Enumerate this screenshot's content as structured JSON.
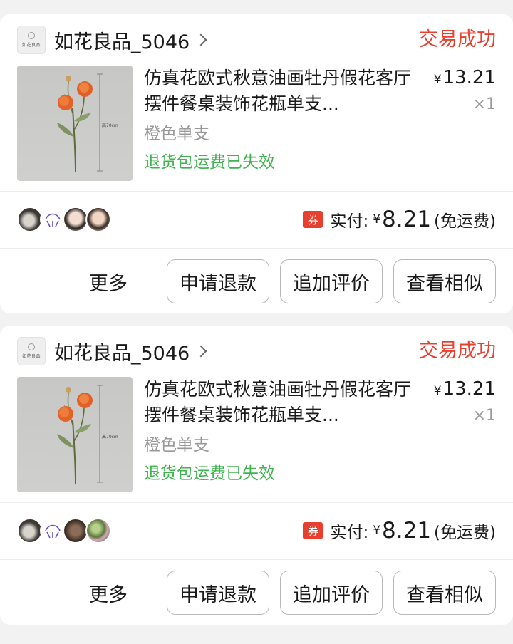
{
  "orders": [
    {
      "shop_name": "如花良品_5046",
      "shop_logo_text": "如花良品",
      "status": "交易成功",
      "product_title": "仿真花欧式秋意油画牡丹假花客厅摆件餐桌装饰花瓶单支...",
      "price_symbol": "¥",
      "price": "13.21",
      "quantity": "×1",
      "spec": "橙色单支",
      "return_note": "退货包运费已失效",
      "image_height_label": "高70cm",
      "avatars": [
        "cat-avatar",
        "sketch-avatar",
        "girl-avatar",
        "girl-avatar"
      ],
      "coupon_label": "券",
      "paid_label": "实付:",
      "paid_symbol": "¥",
      "paid_amount": "8.21",
      "paid_note": "(免运费)",
      "more_label": "更多",
      "buttons": {
        "refund": "申请退款",
        "add_review": "追加评价",
        "similar": "查看相似"
      }
    },
    {
      "shop_name": "如花良品_5046",
      "shop_logo_text": "如花良品",
      "status": "交易成功",
      "product_title": "仿真花欧式秋意油画牡丹假花客厅摆件餐桌装饰花瓶单支...",
      "price_symbol": "¥",
      "price": "13.21",
      "quantity": "×1",
      "spec": "橙色单支",
      "return_note": "退货包运费已失效",
      "image_height_label": "高70cm",
      "avatars": [
        "cat-avatar",
        "sketch-avatar",
        "dark-avatar",
        "plant-avatar"
      ],
      "coupon_label": "券",
      "paid_label": "实付:",
      "paid_symbol": "¥",
      "paid_amount": "8.21",
      "paid_note": "(免运费)",
      "more_label": "更多",
      "buttons": {
        "refund": "申请退款",
        "add_review": "追加评价",
        "similar": "查看相似"
      }
    }
  ],
  "colors": {
    "status": "#e8402e",
    "return_note": "#3fb34f",
    "coupon": "#e8402e"
  }
}
